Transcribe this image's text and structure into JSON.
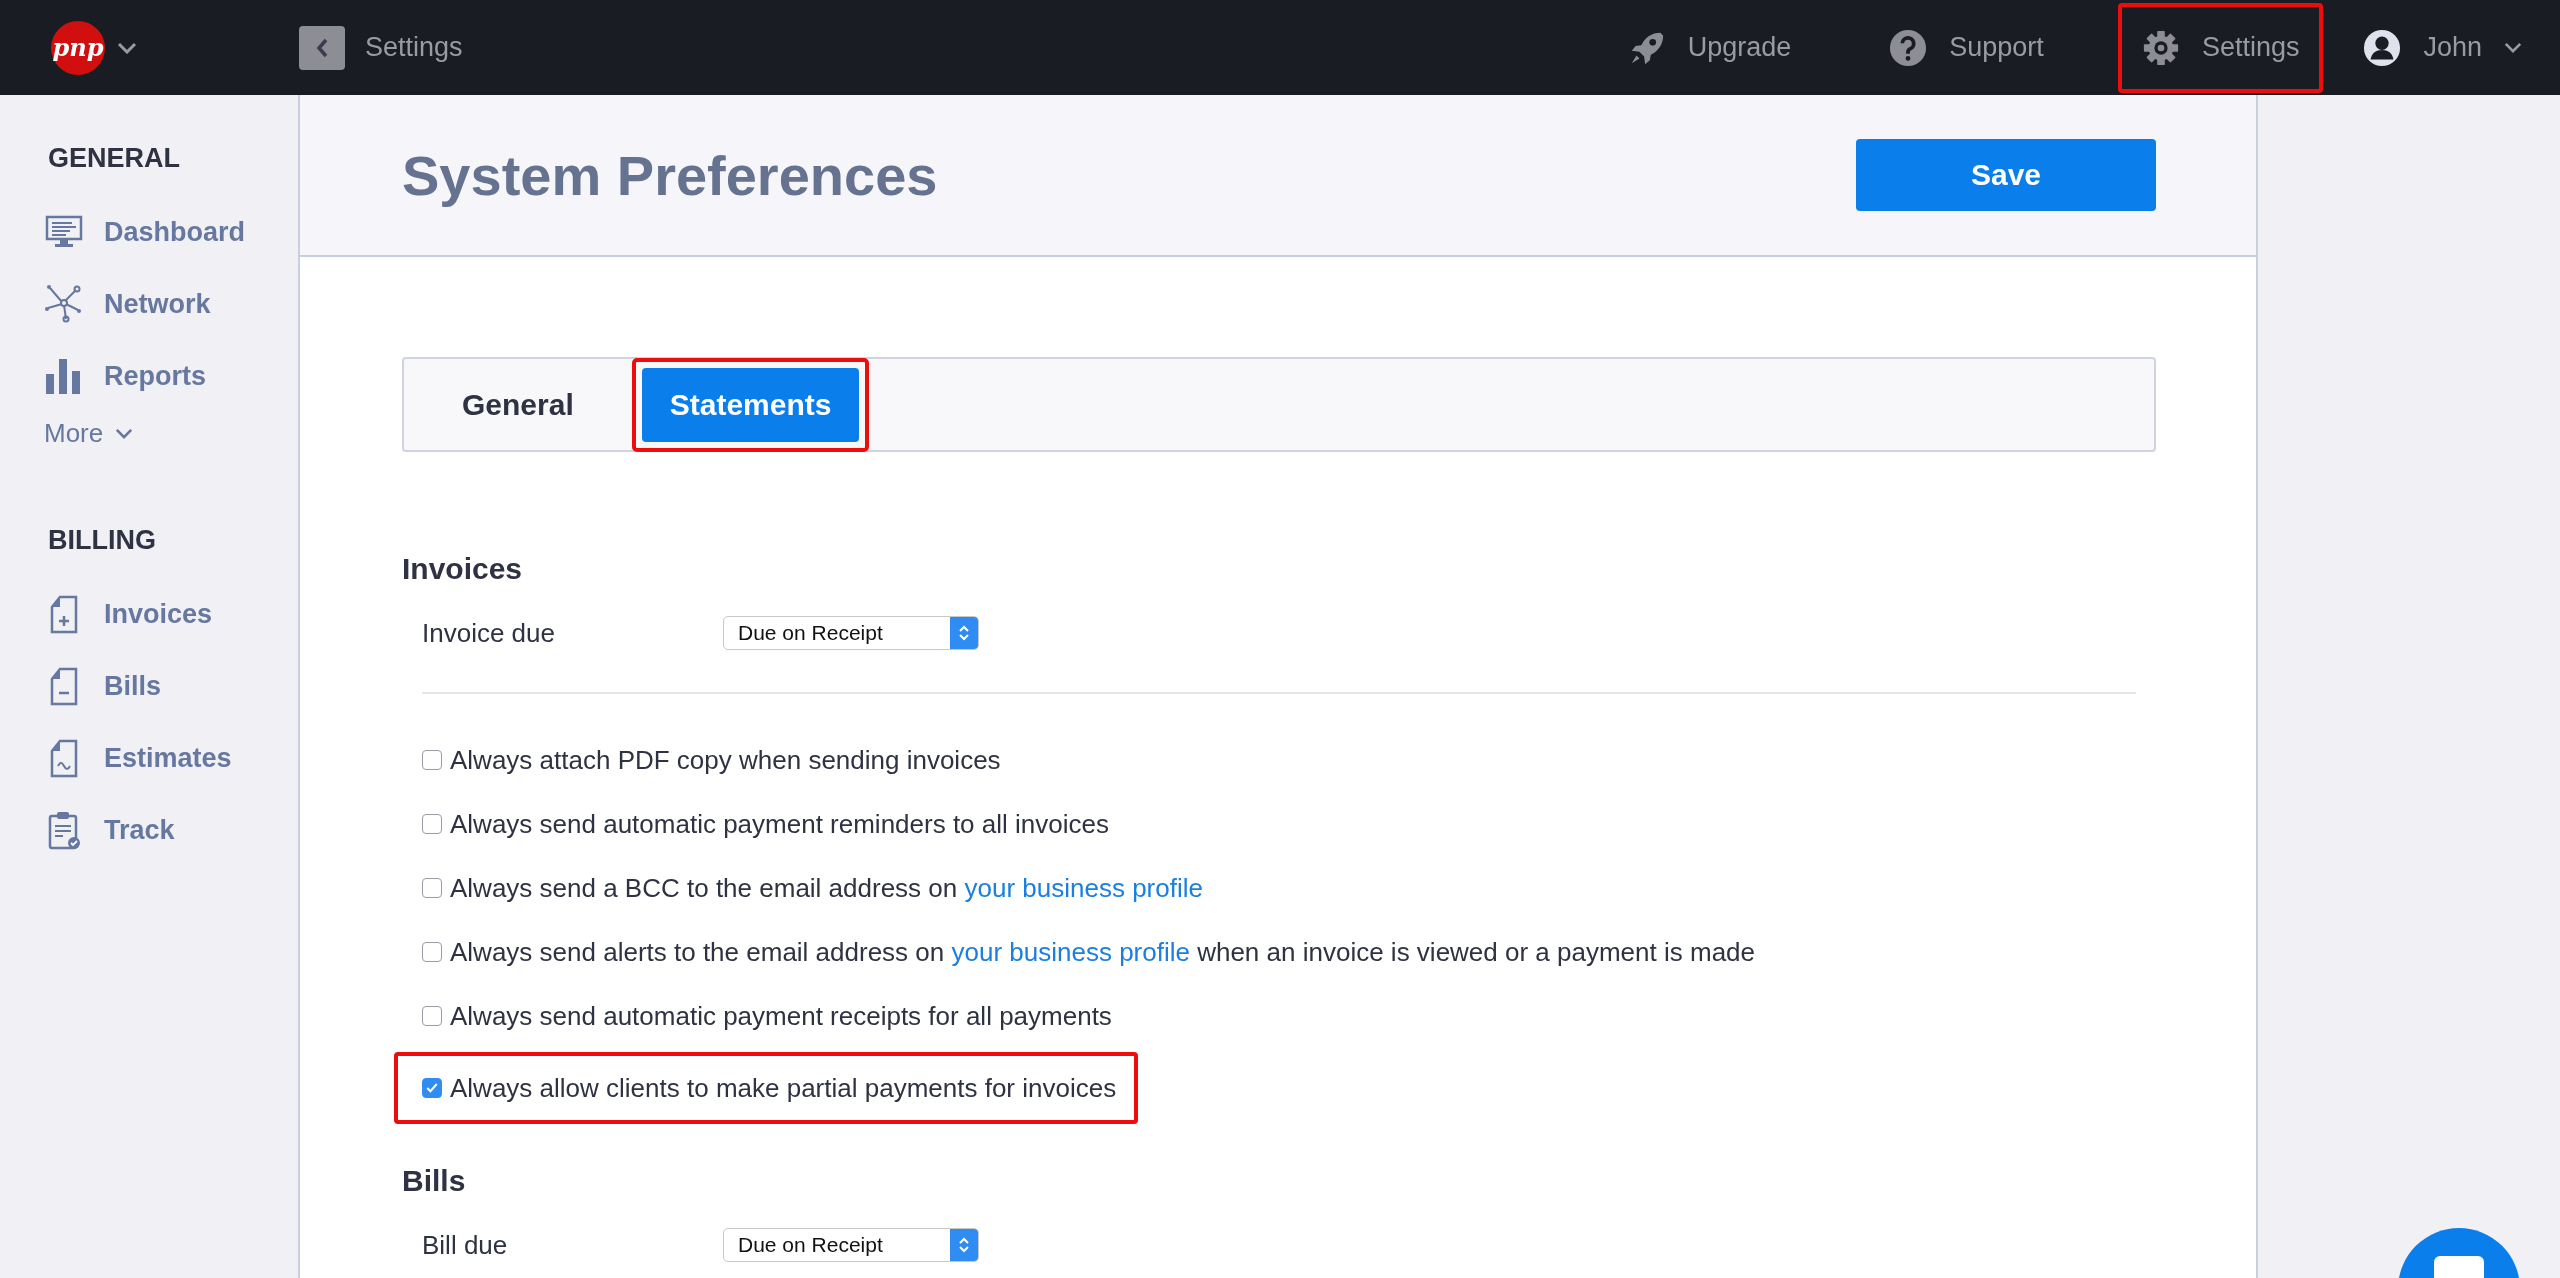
{
  "topbar": {
    "logo": "pnp",
    "back_label": "Settings",
    "nav": [
      {
        "label": "Upgrade",
        "highlighted": false
      },
      {
        "label": "Support",
        "highlighted": false
      },
      {
        "label": "Settings",
        "highlighted": true
      }
    ],
    "user": {
      "name": "John"
    }
  },
  "sidebar": {
    "sections": [
      {
        "heading": "GENERAL",
        "items": [
          {
            "label": "Dashboard"
          },
          {
            "label": "Network"
          },
          {
            "label": "Reports"
          }
        ],
        "more": "More"
      },
      {
        "heading": "BILLING",
        "items": [
          {
            "label": "Invoices"
          },
          {
            "label": "Bills"
          },
          {
            "label": "Estimates"
          },
          {
            "label": "Track"
          }
        ]
      }
    ]
  },
  "page": {
    "title": "System Preferences",
    "save": "Save"
  },
  "tabs": [
    {
      "label": "General",
      "selected": false,
      "highlighted": false
    },
    {
      "label": "Statements",
      "selected": true,
      "highlighted": true
    }
  ],
  "sections": [
    {
      "heading": "Invoices",
      "field": {
        "label": "Invoice due",
        "value": "Due on Receipt"
      },
      "options": [
        {
          "parts": [
            {
              "text": "Always attach PDF copy when sending invoices"
            }
          ],
          "checked": false,
          "highlighted": false
        },
        {
          "parts": [
            {
              "text": "Always send automatic payment reminders to all invoices"
            }
          ],
          "checked": false,
          "highlighted": false
        },
        {
          "parts": [
            {
              "text": "Always send a BCC to the email address on "
            },
            {
              "text": "your business profile",
              "kind": "link"
            }
          ],
          "checked": false,
          "highlighted": false
        },
        {
          "parts": [
            {
              "text": "Always send alerts to the email address on "
            },
            {
              "text": "your business profile",
              "kind": "link"
            },
            {
              "text": " when an invoice is viewed or a payment is made"
            }
          ],
          "checked": false,
          "highlighted": false
        },
        {
          "parts": [
            {
              "text": "Always send automatic payment receipts for all payments"
            }
          ],
          "checked": false,
          "highlighted": false
        },
        {
          "parts": [
            {
              "text": "Always allow clients to make partial payments for invoices"
            }
          ],
          "checked": true,
          "highlighted": true
        }
      ]
    },
    {
      "heading": "Bills",
      "field": {
        "label": "Bill due",
        "value": "Due on Receipt"
      }
    }
  ]
}
